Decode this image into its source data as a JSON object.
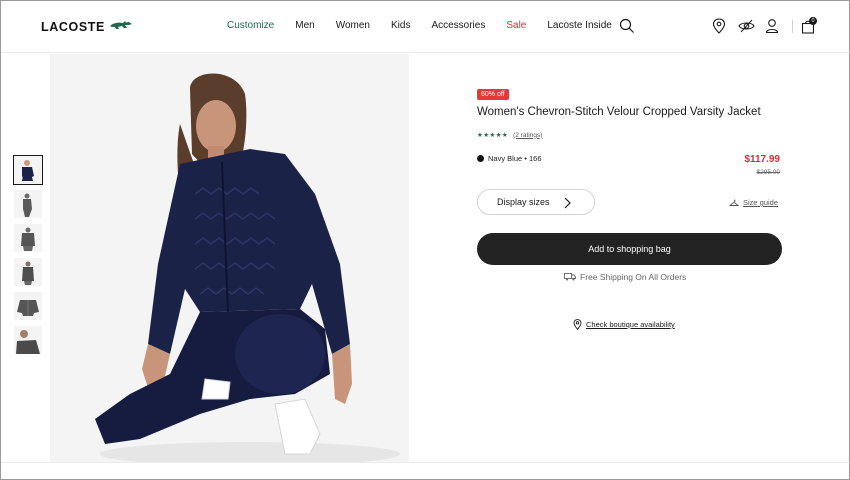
{
  "brand": {
    "logo_text": "LACOSTE"
  },
  "nav": {
    "items": [
      {
        "label": "Customize"
      },
      {
        "label": "Men"
      },
      {
        "label": "Women"
      },
      {
        "label": "Kids"
      },
      {
        "label": "Accessories"
      },
      {
        "label": "Sale"
      },
      {
        "label": "Lacoste Inside"
      }
    ]
  },
  "header": {
    "icons": [
      "search-icon",
      "location-pin-icon",
      "eye-icon",
      "account-icon",
      "shopping-bag-icon"
    ],
    "bag_count": "0"
  },
  "colors": {
    "accent_green": "#1f6a4d",
    "sale_red": "#d32f2f",
    "badge_red": "#e53935",
    "button_dark": "#232323",
    "jacket_navy": "#1b2248"
  },
  "gallery": {
    "thumbnail_count": 6,
    "active_index": 0
  },
  "product": {
    "discount_badge": "60% off",
    "title": "Women's Chevron-Stitch Velour Cropped Varsity Jacket",
    "stars": "★★★★★",
    "ratings_link": "(2 ratings)",
    "color_label": "Navy Blue • 166",
    "price": "$117.99",
    "original_price": "$295.00",
    "display_sizes_label": "Display sizes",
    "size_guide_label": "Size guide",
    "add_to_bag_label": "Add to shopping bag",
    "shipping_text": "Free Shipping On All Orders",
    "boutique_link": "Check boutique availability"
  }
}
